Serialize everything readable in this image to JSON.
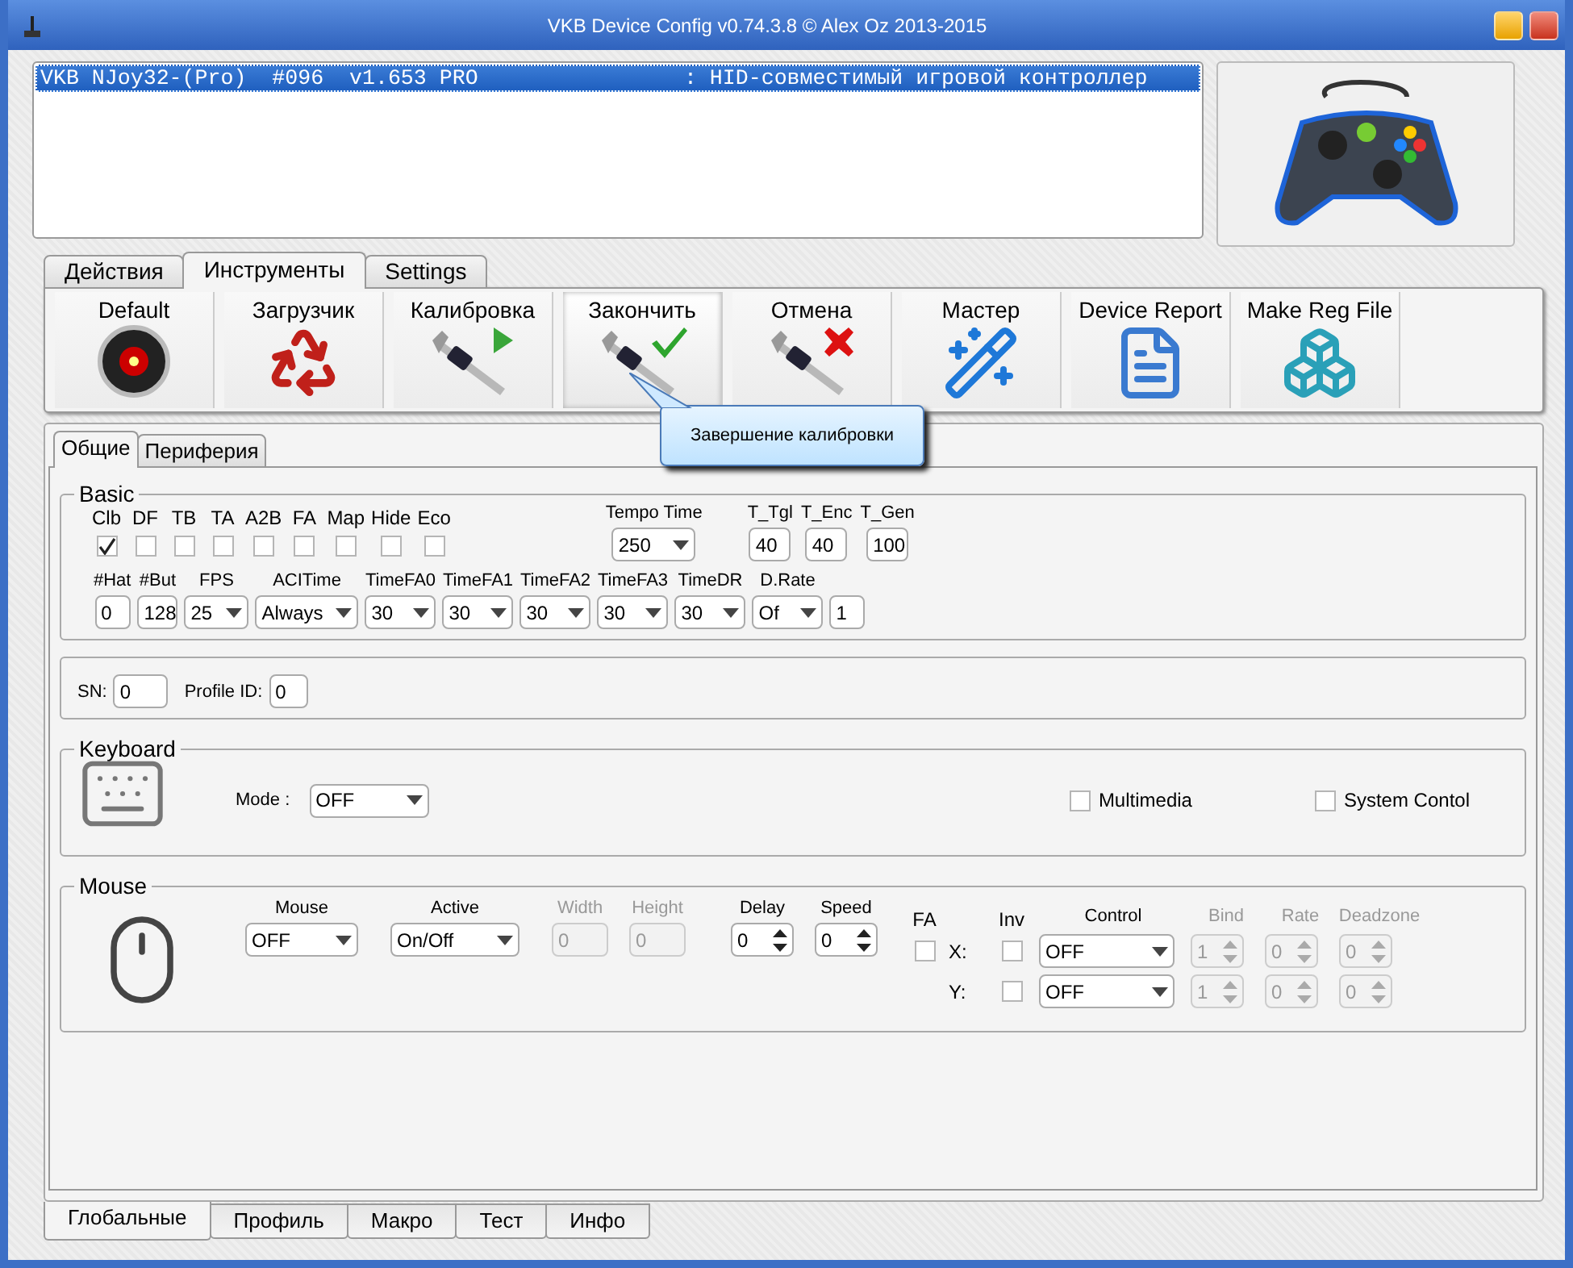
{
  "window": {
    "title": "VKB Device Config v0.74.3.8 © Alex Oz 2013-2015"
  },
  "device_list": [
    {
      "text": "VKB NJoy32-(Pro)  #096  v1.653 PRO                : HID-совместимый игровой контроллер",
      "selected": true
    }
  ],
  "top_tabs": [
    {
      "label": "Действия",
      "selected": false
    },
    {
      "label": "Инструменты",
      "selected": true
    },
    {
      "label": "Settings",
      "selected": false
    }
  ],
  "toolbar": [
    {
      "label": "Default",
      "highlighted": false
    },
    {
      "label": "Загрузчик",
      "highlighted": false
    },
    {
      "label": "Калибровка",
      "highlighted": false
    },
    {
      "label": "Закончить",
      "highlighted": true
    },
    {
      "label": "Отмена",
      "highlighted": false
    },
    {
      "label": "Мастер",
      "highlighted": false
    },
    {
      "label": "Device Report",
      "highlighted": false
    },
    {
      "label": "Make Reg File",
      "highlighted": false
    }
  ],
  "tooltip": {
    "text": "Завершение калибровки"
  },
  "sub_tabs": [
    {
      "label": "Общие",
      "selected": true
    },
    {
      "label": "Периферия",
      "selected": false
    }
  ],
  "basic": {
    "title": "Basic",
    "flags": [
      {
        "label": "Clb",
        "checked": true
      },
      {
        "label": "DF",
        "checked": false
      },
      {
        "label": "TB",
        "checked": false
      },
      {
        "label": "TA",
        "checked": false
      },
      {
        "label": "A2B",
        "checked": false
      },
      {
        "label": "FA",
        "checked": false
      },
      {
        "label": "Map",
        "checked": false
      },
      {
        "label": "Hide",
        "checked": false
      },
      {
        "label": "Eco",
        "checked": false
      }
    ],
    "tempo": {
      "label": "Tempo Time",
      "kind": "select",
      "value": "250"
    },
    "timers": [
      {
        "label": "T_Tgl",
        "kind": "field",
        "value": "40"
      },
      {
        "label": "T_Enc",
        "kind": "field",
        "value": "40"
      },
      {
        "label": "T_Gen",
        "kind": "field",
        "value": "100"
      }
    ],
    "row2": [
      {
        "label": "#Hat",
        "kind": "field",
        "value": "0"
      },
      {
        "label": "#But",
        "kind": "field",
        "value": "128"
      },
      {
        "label": "FPS",
        "kind": "select",
        "value": "25"
      },
      {
        "label": "ACITime",
        "kind": "select",
        "value": "Always"
      },
      {
        "label": "TimeFA0",
        "kind": "select",
        "value": "30"
      },
      {
        "label": "TimeFA1",
        "kind": "select",
        "value": "30"
      },
      {
        "label": "TimeFA2",
        "kind": "select",
        "value": "30"
      },
      {
        "label": "TimeFA3",
        "kind": "select",
        "value": "30"
      },
      {
        "label": "TimeDR",
        "kind": "select",
        "value": "30"
      },
      {
        "label": "D.Rate",
        "kind": "select",
        "value": "Of"
      },
      {
        "kind": "field",
        "value": "1"
      }
    ]
  },
  "ids": [
    {
      "label": "SN:",
      "value": "0"
    },
    {
      "label": "Profile ID:",
      "value": "0"
    }
  ],
  "keyboard": {
    "title": "Keyboard",
    "mode_label": "Mode :",
    "mode": "OFF",
    "options": [
      {
        "label": "Multimedia",
        "checked": false
      },
      {
        "label": "System Contol",
        "checked": false
      }
    ]
  },
  "mouse": {
    "title": "Mouse",
    "controls": [
      {
        "label": "Mouse",
        "kind": "select",
        "value": "OFF",
        "disabled": false
      },
      {
        "label": "Active",
        "kind": "select",
        "value": "On/Off",
        "disabled": false
      },
      {
        "label": "Width",
        "kind": "field",
        "value": "0",
        "disabled": true
      },
      {
        "label": "Height",
        "kind": "field",
        "value": "0",
        "disabled": true
      },
      {
        "label": "Delay",
        "kind": "spinner",
        "value": "0",
        "disabled": false
      },
      {
        "label": "Speed",
        "kind": "spinner",
        "value": "0",
        "disabled": false
      }
    ],
    "fa": {
      "label": "FA",
      "checked": false
    },
    "inv_label": "Inv",
    "axis_columns": [
      {
        "label": "Control",
        "kind": "select",
        "disabled": false
      },
      {
        "label": "Bind",
        "kind": "spinner",
        "disabled": true
      },
      {
        "label": "Rate",
        "kind": "spinner",
        "disabled": true
      },
      {
        "label": "Deadzone",
        "kind": "spinner",
        "disabled": true
      }
    ],
    "axes": [
      {
        "name": "X:",
        "inverted": false,
        "values": [
          "OFF",
          "1",
          "0",
          "0"
        ]
      },
      {
        "name": "Y:",
        "inverted": false,
        "values": [
          "OFF",
          "1",
          "0",
          "0"
        ]
      }
    ]
  },
  "bottom_tabs": [
    {
      "label": "Глобальные",
      "selected": true
    },
    {
      "label": "Профиль",
      "selected": false
    },
    {
      "label": "Макро",
      "selected": false
    },
    {
      "label": "Тест",
      "selected": false
    },
    {
      "label": "Инфо",
      "selected": false
    }
  ]
}
